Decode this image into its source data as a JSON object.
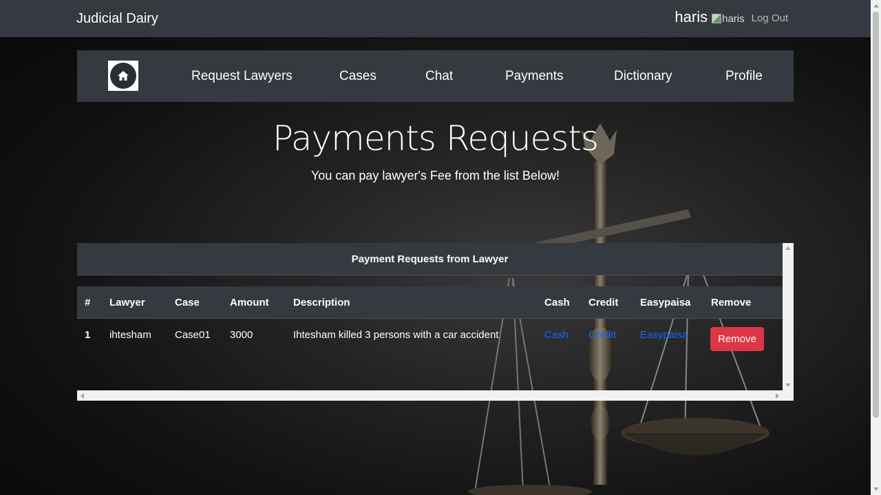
{
  "app": {
    "brand": "Judicial Dairy"
  },
  "user": {
    "name": "haris",
    "avatar_alt": "haris",
    "logout_label": "Log Out"
  },
  "nav": {
    "home_icon": "home-icon",
    "items": [
      {
        "label": "Request Lawyers"
      },
      {
        "label": "Cases"
      },
      {
        "label": "Chat"
      },
      {
        "label": "Payments"
      },
      {
        "label": "Dictionary"
      },
      {
        "label": "Profile"
      }
    ]
  },
  "page": {
    "title": "Payments Requests",
    "subtitle": "You can pay lawyer's Fee from the list Below!"
  },
  "table": {
    "caption": "Payment Requests from Lawyer",
    "columns": [
      "#",
      "Lawyer",
      "Case",
      "Amount",
      "Description",
      "Cash",
      "Credit",
      "Easypaisa",
      "Remove"
    ],
    "rows": [
      {
        "index": "1",
        "lawyer": "ihtesham",
        "case": "Case01",
        "amount": "3000",
        "description": "Ihtesham killed 3 persons with a car accident",
        "cash": "Cash",
        "credit": "Credit",
        "easypaisa": "Easypaisa",
        "remove": "Remove"
      }
    ]
  },
  "colors": {
    "navbar": "#343a40",
    "link": "#0d6efd",
    "danger": "#dc3545"
  }
}
